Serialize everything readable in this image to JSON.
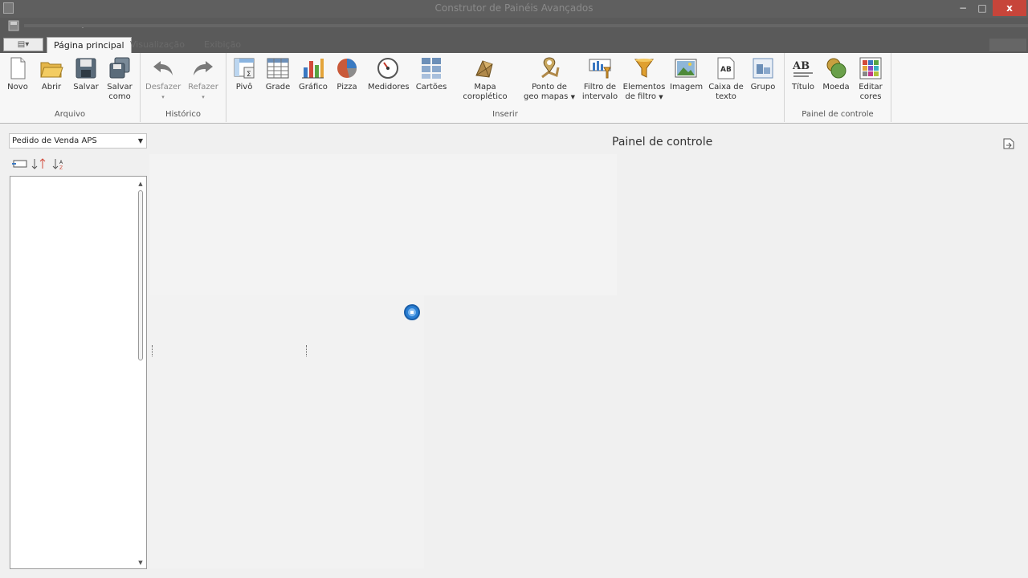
{
  "window": {
    "title": "Construtor de Painéis Avançados",
    "close_glyph": "x",
    "min_glyph": "−",
    "max_glyph": "□"
  },
  "tabs": {
    "file_menu_glyph": "▤▾",
    "active": "Página principal",
    "tab2": "Visualização",
    "tab3": "Exibição"
  },
  "ribbon": {
    "groups": {
      "arquivo": "Arquivo",
      "historico": "Histórico",
      "inserir": "Inserir",
      "painel": "Painel de controle"
    },
    "buttons": {
      "novo": "Novo",
      "abrir": "Abrir",
      "salvar": "Salvar",
      "salvar_como_1": "Salvar",
      "salvar_como_2": "como",
      "desfazer": "Desfazer",
      "refazer": "Refazer",
      "pivo": "Pivô",
      "grade": "Grade",
      "grafico": "Gráfico",
      "pizza": "Pizza",
      "medidores": "Medidores",
      "cartoes": "Cartões",
      "mapa": "Mapa coroplético",
      "ponto_1": "Ponto de",
      "ponto_2": "geo mapas",
      "filtro_1": "Filtro de",
      "filtro_2": "intervalo",
      "elementos_1": "Elementos",
      "elementos_2": "de filtro",
      "imagem": "Imagem",
      "caixa_1": "Caixa de",
      "caixa_2": "texto",
      "grupo": "Grupo",
      "titulo": "Título",
      "moeda": "Moeda",
      "editar_1": "Editar",
      "editar_2": "cores"
    }
  },
  "left_panel": {
    "datasource": "Pedido de Venda APS"
  },
  "dashboard": {
    "title": "Painel de controle"
  },
  "colors": {
    "titlebar": "#5f5f5f",
    "close": "#c7453a",
    "ribbon": "#f7f7f7",
    "accent_blue": "#2a7fd4"
  },
  "icons": [
    "new-document-icon",
    "open-folder-icon",
    "save-disk-icon",
    "save-as-icon",
    "undo-icon",
    "redo-icon",
    "pivot-icon",
    "grid-icon",
    "chart-icon",
    "pie-icon",
    "gauge-icon",
    "cards-icon",
    "choropleth-map-icon",
    "geo-point-icon",
    "range-filter-icon",
    "filter-elements-icon",
    "image-icon",
    "textbox-icon",
    "group-icon",
    "title-icon",
    "currency-icon",
    "edit-colors-icon",
    "export-icon",
    "busy-spinner-icon"
  ]
}
